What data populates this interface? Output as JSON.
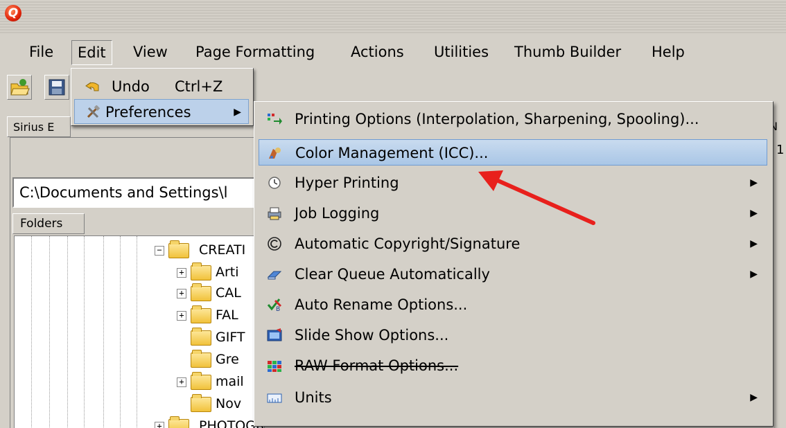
{
  "app": {
    "icon_letter": "Q",
    "icon_name": "qimage-app-icon"
  },
  "menubar": {
    "items": [
      "File",
      "Edit",
      "View",
      "Page Formatting",
      "Actions",
      "Utilities",
      "Thumb Builder",
      "Help"
    ],
    "active": "Edit"
  },
  "toolbar": {
    "buttons": [
      {
        "icon": "open-folder-icon"
      },
      {
        "icon": "save-disk-icon"
      }
    ]
  },
  "tabs": {
    "first_tab_partial": "Sirius E",
    "right_partial_tab": "N",
    "right_partial_num": "1"
  },
  "path_field": {
    "value": "C:\\Documents and Settings\\l"
  },
  "folders_tab": {
    "label": "Folders"
  },
  "tree": {
    "nodes": [
      {
        "label": "CREATI",
        "expander": "−"
      },
      {
        "label": "Arti",
        "expander": "+"
      },
      {
        "label": "CAL",
        "expander": "+"
      },
      {
        "label": "FAL",
        "expander": "+"
      },
      {
        "label": "GIFT",
        "expander": ""
      },
      {
        "label": "Gre",
        "expander": ""
      },
      {
        "label": "mail",
        "expander": "+"
      },
      {
        "label": "Nov",
        "expander": ""
      },
      {
        "label": "PHOTOGRAPHY_STOCK",
        "expander": "+"
      }
    ]
  },
  "edit_menu": {
    "undo_label": "Undo",
    "undo_shortcut": "Ctrl+Z",
    "preferences_label": "Preferences",
    "submenu_arrow": "▶"
  },
  "preferences_menu": {
    "items": [
      {
        "label": "Printing Options (Interpolation, Sharpening, Spooling)...",
        "icon": "printing-options-icon",
        "has_submenu": false
      },
      {
        "label": "Color Management (ICC)...",
        "icon": "color-management-icon",
        "has_submenu": false,
        "highlighted": true
      },
      {
        "label": "Hyper Printing",
        "icon": "hyper-printing-clock-icon",
        "has_submenu": true
      },
      {
        "label": "Job Logging",
        "icon": "job-logging-printer-icon",
        "has_submenu": true
      },
      {
        "label": "Automatic Copyright/Signature",
        "icon": "copyright-icon",
        "has_submenu": true
      },
      {
        "label": "Clear Queue Automatically",
        "icon": "eraser-icon",
        "has_submenu": true
      },
      {
        "label": "Auto Rename Options...",
        "icon": "auto-rename-icon",
        "has_submenu": false
      },
      {
        "label": "Slide Show Options...",
        "icon": "slideshow-icon",
        "has_submenu": false
      },
      {
        "label": "RAW Format Options...",
        "icon": "raw-format-icon",
        "has_submenu": false,
        "strikethrough": true
      },
      {
        "label": "Units",
        "icon": "units-ruler-icon",
        "has_submenu": true
      }
    ],
    "arrow_glyph": "▶"
  },
  "annotation": {
    "color": "#e8201c"
  },
  "colors": {
    "face": "#d4d0c8",
    "highlight": "#bcd1ea",
    "highlight_border": "#6f9bd1"
  }
}
